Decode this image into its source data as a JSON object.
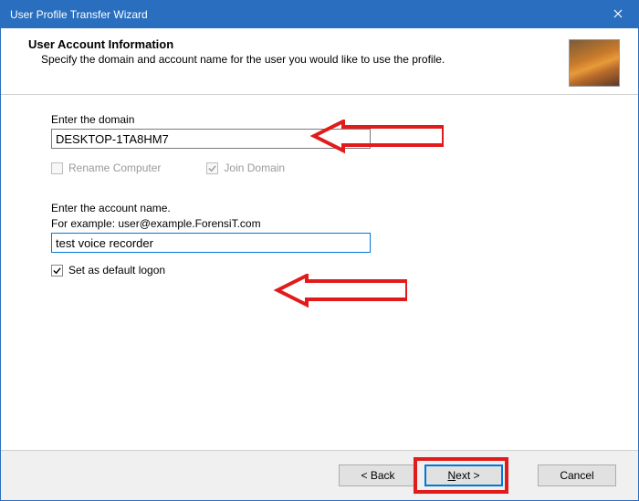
{
  "window": {
    "title": "User Profile Transfer Wizard"
  },
  "header": {
    "title": "User Account Information",
    "subtitle": "Specify the domain and account name for the user you would like to use the profile."
  },
  "form": {
    "domain_label": "Enter the domain",
    "domain_value": "DESKTOP-1TA8HM7",
    "rename_computer_label": "Rename Computer",
    "rename_computer_checked": "false",
    "join_domain_label": "Join Domain",
    "join_domain_checked": "true",
    "account_label_line1": "Enter the account name.",
    "account_label_line2": "For example: user@example.ForensiT.com",
    "account_value": "test voice recorder",
    "default_logon_label": "Set as default logon",
    "default_logon_checked": "true"
  },
  "buttons": {
    "back": "< Back",
    "next": "Next >",
    "cancel": "Cancel"
  },
  "annotation": {
    "highlight_color": "#e11b1b"
  }
}
